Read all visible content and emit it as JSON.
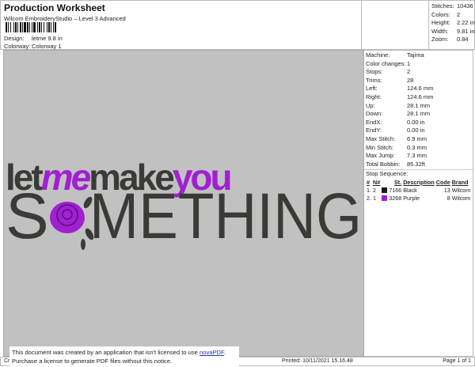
{
  "header": {
    "title": "Production Worksheet",
    "subtitle": "Wilcom EmbroideryStudio – Level 3 Advanced",
    "design_label": "Design:",
    "design_value": "letme 9.8 in",
    "colorway_label": "Colorway:",
    "colorway_value": "Colorway 1"
  },
  "stats": [
    {
      "label": "Stitches:",
      "value": "10436"
    },
    {
      "label": "Colors:",
      "value": "2"
    },
    {
      "label": "Height:",
      "value": "2.22 in"
    },
    {
      "label": "Width:",
      "value": "9.81 in"
    },
    {
      "label": "Zoom:",
      "value": "0.84"
    }
  ],
  "details": [
    {
      "label": "Machine:",
      "value": "Tajima"
    },
    {
      "label": "Color changes:",
      "value": "1"
    },
    {
      "label": "Stops:",
      "value": "2"
    },
    {
      "label": "Trims:",
      "value": "28"
    },
    {
      "label": "Left:",
      "value": "124.6 mm"
    },
    {
      "label": "Right:",
      "value": "124.6 mm"
    },
    {
      "label": "Up:",
      "value": "28.1 mm"
    },
    {
      "label": "Down:",
      "value": "28.1 mm"
    },
    {
      "label": "EndX:",
      "value": "0.00 in"
    },
    {
      "label": "EndY:",
      "value": "0.00 in"
    },
    {
      "label": "Max Stitch:",
      "value": "6.9 mm"
    },
    {
      "label": "Min Stitch:",
      "value": "0.3 mm"
    },
    {
      "label": "Max Jump:",
      "value": "7.3 mm"
    },
    {
      "label": "Total Bobbin:",
      "value": "85.32ft"
    }
  ],
  "stop_sequence": {
    "title": "Stop Sequence:",
    "columns": [
      "#",
      "N#",
      "St.",
      "Description",
      "Code",
      "Brand"
    ],
    "rows": [
      {
        "idx": "1.",
        "n": "2",
        "color": "#1a1a1a",
        "st": "7166",
        "desc": "Black",
        "code": "13",
        "brand": "Wilcom"
      },
      {
        "idx": "2.",
        "n": "1",
        "color": "#9b1fc9",
        "st": "3268",
        "desc": "Purple",
        "code": "8",
        "brand": "Wilcom"
      }
    ]
  },
  "artwork": {
    "line1_a": "let",
    "line1_b": "me",
    "line1_c": "make",
    "line1_d": "you",
    "line2_a": "S",
    "line2_b": "METHING",
    "thread_dark": "#3a3a36",
    "thread_purple": "#a020d0"
  },
  "footer": {
    "left": "Cr",
    "printed": "Printed: 10/11/2021 15.16.48",
    "page": "Page 1 of 1"
  },
  "notice": {
    "line1": "This document was created by an application that isn't licensed to use ",
    "link": "novaPDF",
    "line1_end": ".",
    "line2": "Purchase a license to generate PDF files without this notice."
  }
}
